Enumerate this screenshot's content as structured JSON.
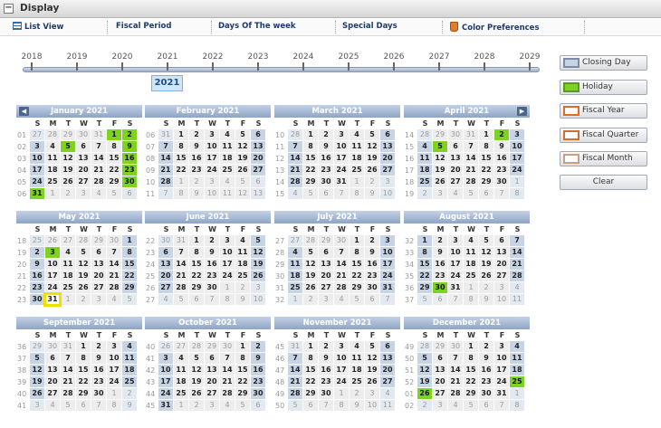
{
  "header": {
    "title": "Display"
  },
  "toolbar": [
    {
      "label": "List View",
      "icon": "list-icon"
    },
    {
      "label": "Fiscal Period"
    },
    {
      "label": "Days Of The week"
    },
    {
      "label": "Special Days"
    },
    {
      "label": "Color Preferences",
      "icon": "paint-bucket-icon"
    }
  ],
  "timeline": {
    "years": [
      "2018",
      "2019",
      "2020",
      "2021",
      "2022",
      "2023",
      "2024",
      "2025",
      "2026",
      "2027",
      "2028",
      "2029"
    ],
    "selected": "2021"
  },
  "calendar": {
    "day_headers": [
      "S",
      "M",
      "T",
      "W",
      "T",
      "F",
      "S"
    ],
    "months": [
      {
        "name": "January 2021",
        "first": 5,
        "len": 31,
        "prevLen": 31,
        "week0": 1,
        "holidays": [
          1,
          2,
          5,
          9,
          16,
          23,
          30,
          31
        ]
      },
      {
        "name": "February 2021",
        "first": 1,
        "len": 28,
        "prevLen": 31,
        "week0": 6,
        "holidays": []
      },
      {
        "name": "March 2021",
        "first": 1,
        "len": 31,
        "prevLen": 28,
        "week0": 10,
        "holidays": []
      },
      {
        "name": "April 2021",
        "first": 4,
        "len": 30,
        "prevLen": 31,
        "week0": 14,
        "holidays": [
          2,
          5
        ]
      },
      {
        "name": "May 2021",
        "first": 6,
        "len": 31,
        "prevLen": 30,
        "week0": 18,
        "holidays": [
          3
        ]
      },
      {
        "name": "June 2021",
        "first": 2,
        "len": 30,
        "prevLen": 31,
        "week0": 22,
        "holidays": []
      },
      {
        "name": "July 2021",
        "first": 4,
        "len": 31,
        "prevLen": 30,
        "week0": 27,
        "holidays": []
      },
      {
        "name": "August 2021",
        "first": 0,
        "len": 31,
        "prevLen": 31,
        "week0": 32,
        "holidays": [
          30
        ]
      },
      {
        "name": "September 2021",
        "first": 3,
        "len": 30,
        "prevLen": 31,
        "week0": 36,
        "holidays": []
      },
      {
        "name": "October 2021",
        "first": 5,
        "len": 31,
        "prevLen": 30,
        "week0": 40,
        "holidays": []
      },
      {
        "name": "November 2021",
        "first": 1,
        "len": 30,
        "prevLen": 31,
        "week0": 45,
        "holidays": []
      },
      {
        "name": "December 2021",
        "first": 3,
        "len": 31,
        "prevLen": 30,
        "week0": 49,
        "holidays": [
          25,
          26
        ]
      }
    ],
    "today": {
      "month": 4,
      "day": 31
    }
  },
  "legend": {
    "buttons": [
      {
        "label": "Closing Day",
        "color": "#c7d4e6",
        "border": "#7b8aa5"
      },
      {
        "label": "Holiday",
        "color": "#7ed321",
        "border": "#5a9a18"
      },
      {
        "label": "Fiscal Year",
        "color": "#ffffff",
        "border": "#e06a2a"
      },
      {
        "label": "Fiscal Quarter",
        "color": "#ffffff",
        "border": "#d0702e"
      },
      {
        "label": "Fiscal Month",
        "color": "#ffffff",
        "border": "#c8a084"
      }
    ],
    "clear": "Clear"
  }
}
